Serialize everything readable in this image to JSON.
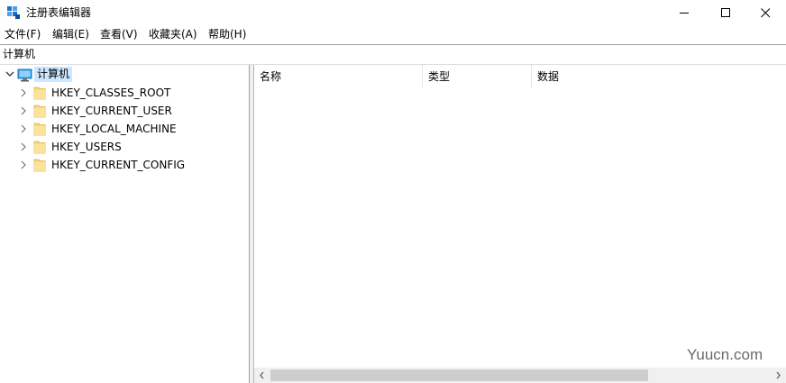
{
  "window": {
    "title": "注册表编辑器",
    "accent_color": "#0078d7"
  },
  "menu": {
    "file": "文件(F)",
    "edit": "编辑(E)",
    "view": "查看(V)",
    "favorites": "收藏夹(A)",
    "help": "帮助(H)"
  },
  "address": {
    "path": "计算机"
  },
  "tree": {
    "root_label": "计算机",
    "items": [
      {
        "label": "HKEY_CLASSES_ROOT"
      },
      {
        "label": "HKEY_CURRENT_USER"
      },
      {
        "label": "HKEY_LOCAL_MACHINE"
      },
      {
        "label": "HKEY_USERS"
      },
      {
        "label": "HKEY_CURRENT_CONFIG"
      }
    ]
  },
  "list": {
    "columns": [
      "名称",
      "类型",
      "数据"
    ]
  },
  "watermark": "Yuucn.com"
}
